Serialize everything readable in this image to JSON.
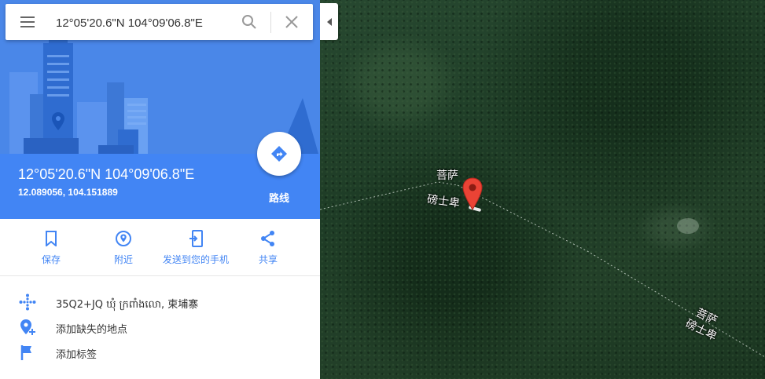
{
  "search": {
    "value": "12°05'20.6\"N 104°09'06.8\"E",
    "menu_icon": "hamburger-menu-icon",
    "search_icon": "search-icon",
    "clear_icon": "close-icon"
  },
  "place": {
    "title": "12°05'20.6\"N 104°09'06.8\"E",
    "decimal": "12.089056, 104.151889",
    "route_label": "路线"
  },
  "actions": [
    {
      "label": "保存",
      "icon": "bookmark-icon"
    },
    {
      "label": "附近",
      "icon": "nearby-icon"
    },
    {
      "label": "发送到您的手机",
      "icon": "send-to-phone-icon"
    },
    {
      "label": "共享",
      "icon": "share-icon"
    }
  ],
  "info": [
    {
      "text": "35Q2+JQ ឃុំ ក្រពាំងលោ, 柬埔寨",
      "icon": "plus-code-icon"
    },
    {
      "text": "添加缺失的地点",
      "icon": "add-place-icon"
    },
    {
      "text": "添加标签",
      "icon": "flag-icon"
    }
  ],
  "map": {
    "labels": [
      "菩萨",
      "磅士卑",
      "菩萨",
      "磅士卑"
    ],
    "marker_color": "#ea4335"
  },
  "colors": {
    "accent": "#4285f4",
    "hero": "#4a87e8"
  }
}
